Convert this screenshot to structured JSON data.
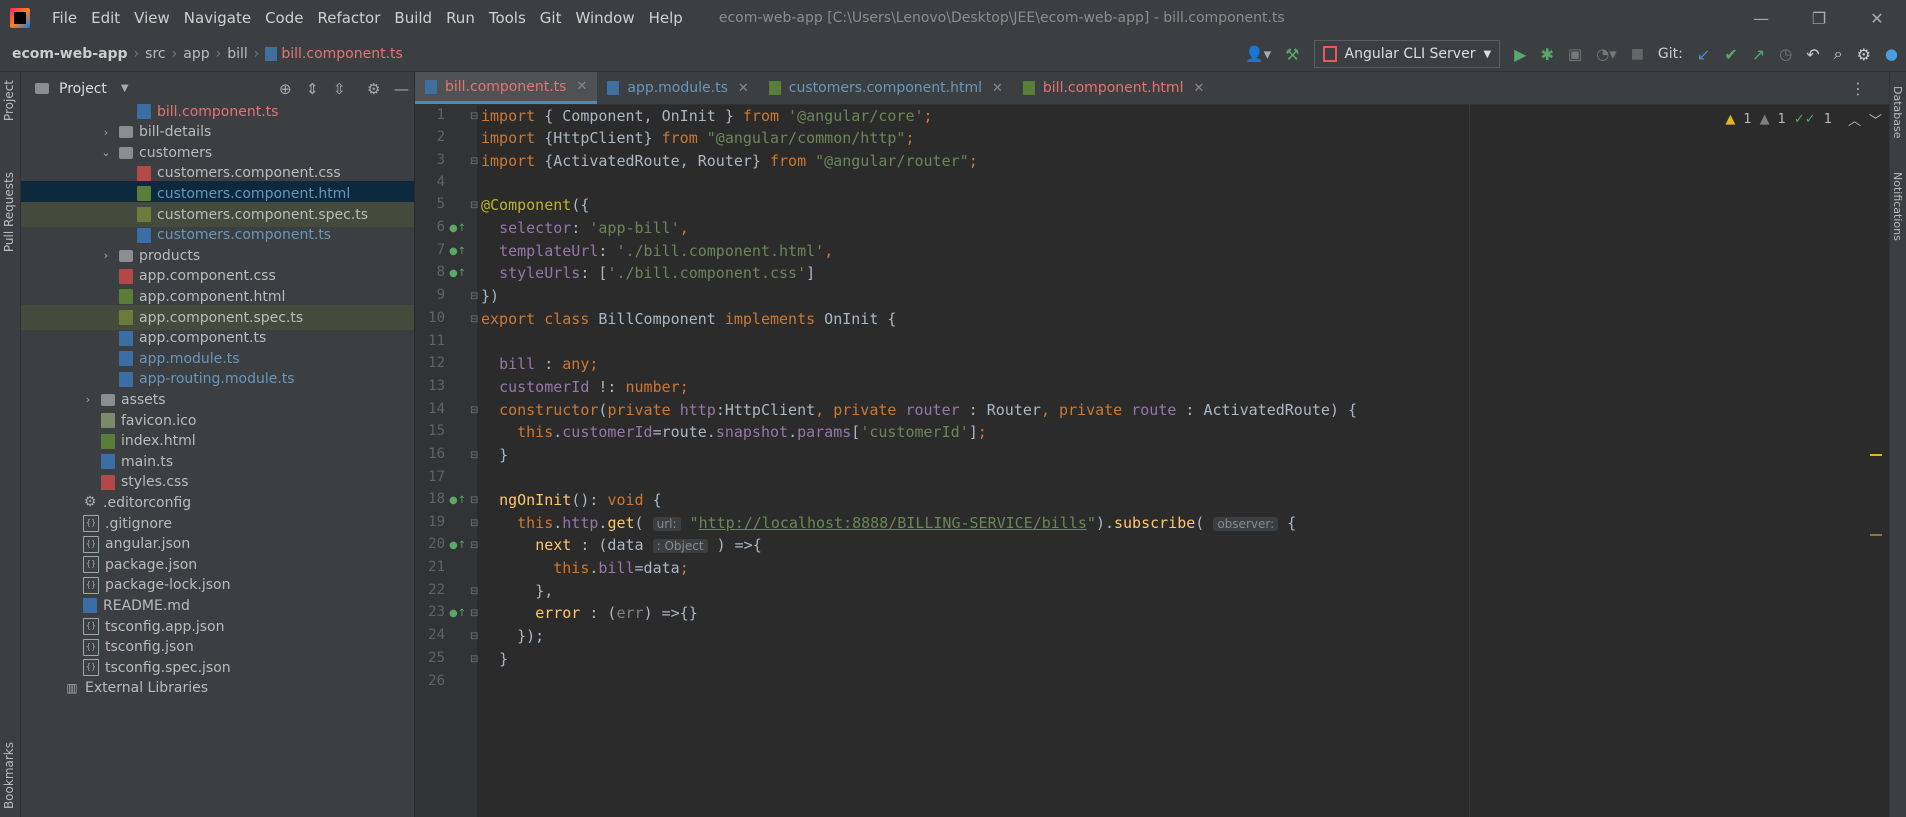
{
  "menu": [
    "File",
    "Edit",
    "View",
    "Navigate",
    "Code",
    "Refactor",
    "Build",
    "Run",
    "Tools",
    "Git",
    "Window",
    "Help"
  ],
  "window_title": "ecom-web-app [C:\\Users\\Lenovo\\Desktop\\JEE\\ecom-web-app] - bill.component.ts",
  "breadcrumb": {
    "project": "ecom-web-app",
    "src": "src",
    "app": "app",
    "bill": "bill",
    "file": "bill.component.ts"
  },
  "toolbar": {
    "run_config": "Angular CLI Server",
    "git_label": "Git:"
  },
  "sidebar": {
    "project_tab": "Project",
    "pull_requests": "Pull Requests",
    "bookmarks": "Bookmarks"
  },
  "project_panel": {
    "title": "Project",
    "items": [
      {
        "label": "bill.component.ts",
        "type": "ts",
        "indent": 4,
        "color": "red"
      },
      {
        "label": "bill-details",
        "type": "folder",
        "indent": 3,
        "chev": "right"
      },
      {
        "label": "customers",
        "type": "folder",
        "indent": 3,
        "chev": "down"
      },
      {
        "label": "customers.component.css",
        "type": "css",
        "indent": 4
      },
      {
        "label": "customers.component.html",
        "type": "html",
        "indent": 4,
        "color": "blue",
        "state": "sel"
      },
      {
        "label": "customers.component.spec.ts",
        "type": "spec",
        "indent": 4,
        "state": "hl"
      },
      {
        "label": "customers.component.ts",
        "type": "ts",
        "indent": 4,
        "color": "blue"
      },
      {
        "label": "products",
        "type": "folder",
        "indent": 3,
        "chev": "right"
      },
      {
        "label": "app.component.css",
        "type": "css",
        "indent": 3
      },
      {
        "label": "app.component.html",
        "type": "html",
        "indent": 3
      },
      {
        "label": "app.component.spec.ts",
        "type": "spec",
        "indent": 3,
        "state": "hl"
      },
      {
        "label": "app.component.ts",
        "type": "ts",
        "indent": 3
      },
      {
        "label": "app.module.ts",
        "type": "ts",
        "indent": 3,
        "color": "blue"
      },
      {
        "label": "app-routing.module.ts",
        "type": "ts",
        "indent": 3,
        "color": "blue"
      },
      {
        "label": "assets",
        "type": "folder",
        "indent": 2,
        "chev": "right"
      },
      {
        "label": "favicon.ico",
        "type": "ico",
        "indent": 2
      },
      {
        "label": "index.html",
        "type": "html",
        "indent": 2
      },
      {
        "label": "main.ts",
        "type": "ts",
        "indent": 2
      },
      {
        "label": "styles.css",
        "type": "css",
        "indent": 2
      },
      {
        "label": ".editorconfig",
        "type": "gear",
        "indent": 1
      },
      {
        "label": ".gitignore",
        "type": "json",
        "indent": 1
      },
      {
        "label": "angular.json",
        "type": "json",
        "indent": 1
      },
      {
        "label": "package.json",
        "type": "json",
        "indent": 1
      },
      {
        "label": "package-lock.json",
        "type": "json",
        "indent": 1
      },
      {
        "label": "README.md",
        "type": "md",
        "indent": 1
      },
      {
        "label": "tsconfig.app.json",
        "type": "json",
        "indent": 1
      },
      {
        "label": "tsconfig.json",
        "type": "json",
        "indent": 1
      },
      {
        "label": "tsconfig.spec.json",
        "type": "json",
        "indent": 1
      },
      {
        "label": "External Libraries",
        "type": "lib",
        "indent": 0
      }
    ]
  },
  "tabs": [
    {
      "label": "bill.component.ts",
      "type": "ts",
      "active": true,
      "color": "red"
    },
    {
      "label": "app.module.ts",
      "type": "ts",
      "color": "blue"
    },
    {
      "label": "customers.component.html",
      "type": "html",
      "color": "blue"
    },
    {
      "label": "bill.component.html",
      "type": "html",
      "color": "red"
    }
  ],
  "inspections": {
    "warnings": "1",
    "weak": "1",
    "ok": "1"
  },
  "right_strip": {
    "database": "Database",
    "notifications": "Notifications"
  },
  "code_lines": [
    "import { Component, OnInit } from '@angular/core';",
    "import {HttpClient} from \"@angular/common/http\";",
    "import {ActivatedRoute, Router} from \"@angular/router\";",
    "",
    "@Component({",
    "  selector: 'app-bill',",
    "  templateUrl: './bill.component.html',",
    "  styleUrls: ['./bill.component.css']",
    "})",
    "export class BillComponent implements OnInit {",
    "",
    "  bill : any;",
    "  customerId !: number;",
    "  constructor(private http:HttpClient, private router : Router, private route : ActivatedRoute) {",
    "    this.customerId=route.snapshot.params['customerId'];",
    "  }",
    "",
    "  ngOnInit(): void {",
    "    this.http.get( url: \"http://localhost:8888/BILLING-SERVICE/bills\").subscribe( observer: {",
    "      next : (data : Object ) =>{",
    "        this.bill=data;",
    "      },",
    "      error : (err) =>{}",
    "    });",
    "  }",
    ""
  ],
  "code_tokens": {
    "c1_kw": "import",
    "c1_a": " { Component, OnInit } ",
    "c1_from": "from",
    "c1_str": " '@angular/core'",
    "c2_kw": "import",
    "c2_a": " {HttpClient} ",
    "c2_from": "from",
    "c2_str": " \"@angular/common/http\"",
    "c3_kw": "import",
    "c3_a": " {ActivatedRoute, Router} ",
    "c3_from": "from",
    "c3_str": " \"@angular/router\"",
    "c5_ann": "@Component",
    "c5_a": "({",
    "c6_p": "selector",
    "c6_s": "'app-bill'",
    "c7_p": "templateUrl",
    "c7_s": "'./bill.component.html'",
    "c8_p": "styleUrls",
    "c8_s": "'./bill.component.css'",
    "c9": "})",
    "c10_kw1": "export",
    "c10_kw2": "class",
    "c10_a": " BillComponent ",
    "c10_kw3": "implements",
    "c10_b": " OnInit {",
    "c12_p": "bill",
    "c12_kw": "any",
    "c13_p": "customerId",
    "c13_kw": "number",
    "c14_kw": "constructor",
    "c14_priv": "private",
    "c14_http": "http",
    "c14_a": ":HttpClient",
    "c14_router": "router",
    "c14_b": " : Router",
    "c14_route": "route",
    "c14_c": " : ActivatedRoute) {",
    "c15_this": "this",
    "c15_p": "customerId",
    "c15_a": "=route.",
    "c15_snap": "snapshot",
    "c15_params": "params",
    "c15_s": "'customerId'",
    "c16": "}",
    "c18_fn": "ngOnInit",
    "c18_a": "(): ",
    "c18_kw": "void",
    "c18_b": " {",
    "c19_this": "this",
    "c19_http": "http",
    "c19_get": "get",
    "c19_hint_url": "url:",
    "c19_url": "http://localhost:8888/BILLING-SERVICE/bills",
    "c19_sub": "subscribe",
    "c19_hint_obs": "observer:",
    "c20_next": "next",
    "c20_a": " : (data ",
    "c20_hint": ": Object",
    "c20_b": " ) =>{",
    "c21_this": "this",
    "c21_p": "bill",
    "c21_a": "=data",
    "c22": "},",
    "c23_err": "error",
    "c23_a": " : (",
    "c23_e": "err",
    "c23_b": ") =>{}",
    "c24": "});",
    "c25": "}"
  },
  "colors": {
    "accent": "#4a88c7",
    "keyword": "#cc7832",
    "string": "#6a8759",
    "function": "#ffc66d",
    "property": "#9876aa"
  }
}
